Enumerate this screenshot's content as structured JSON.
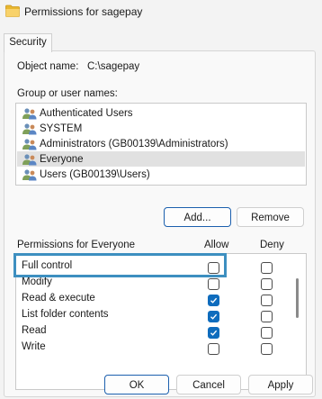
{
  "window": {
    "title": "Permissions for sagepay",
    "icon": "folder-icon"
  },
  "tabs": [
    {
      "label": "Security"
    }
  ],
  "object": {
    "label": "Object name:",
    "value": "C:\\sagepay"
  },
  "group": {
    "label": "Group or user names:",
    "items": [
      {
        "label": "Authenticated Users",
        "selected": false
      },
      {
        "label": "SYSTEM",
        "selected": false
      },
      {
        "label": "Administrators (GB00139\\Administrators)",
        "selected": false
      },
      {
        "label": "Everyone",
        "selected": true
      },
      {
        "label": "Users (GB00139\\Users)",
        "selected": false
      }
    ]
  },
  "buttons": {
    "add": "Add...",
    "remove": "Remove",
    "ok": "OK",
    "cancel": "Cancel",
    "apply": "Apply"
  },
  "permissions": {
    "header": "Permissions for Everyone",
    "allow_header": "Allow",
    "deny_header": "Deny",
    "rows": [
      {
        "name": "Full control",
        "allow": false,
        "deny": false
      },
      {
        "name": "Modify",
        "allow": false,
        "deny": false
      },
      {
        "name": "Read & execute",
        "allow": true,
        "deny": false
      },
      {
        "name": "List folder contents",
        "allow": true,
        "deny": false
      },
      {
        "name": "Read",
        "allow": true,
        "deny": false
      },
      {
        "name": "Write",
        "allow": false,
        "deny": false
      }
    ]
  },
  "colors": {
    "accent": "#0f6cbd",
    "highlight_border": "#3d8fc0",
    "selected_row": "#e1e1e1"
  }
}
